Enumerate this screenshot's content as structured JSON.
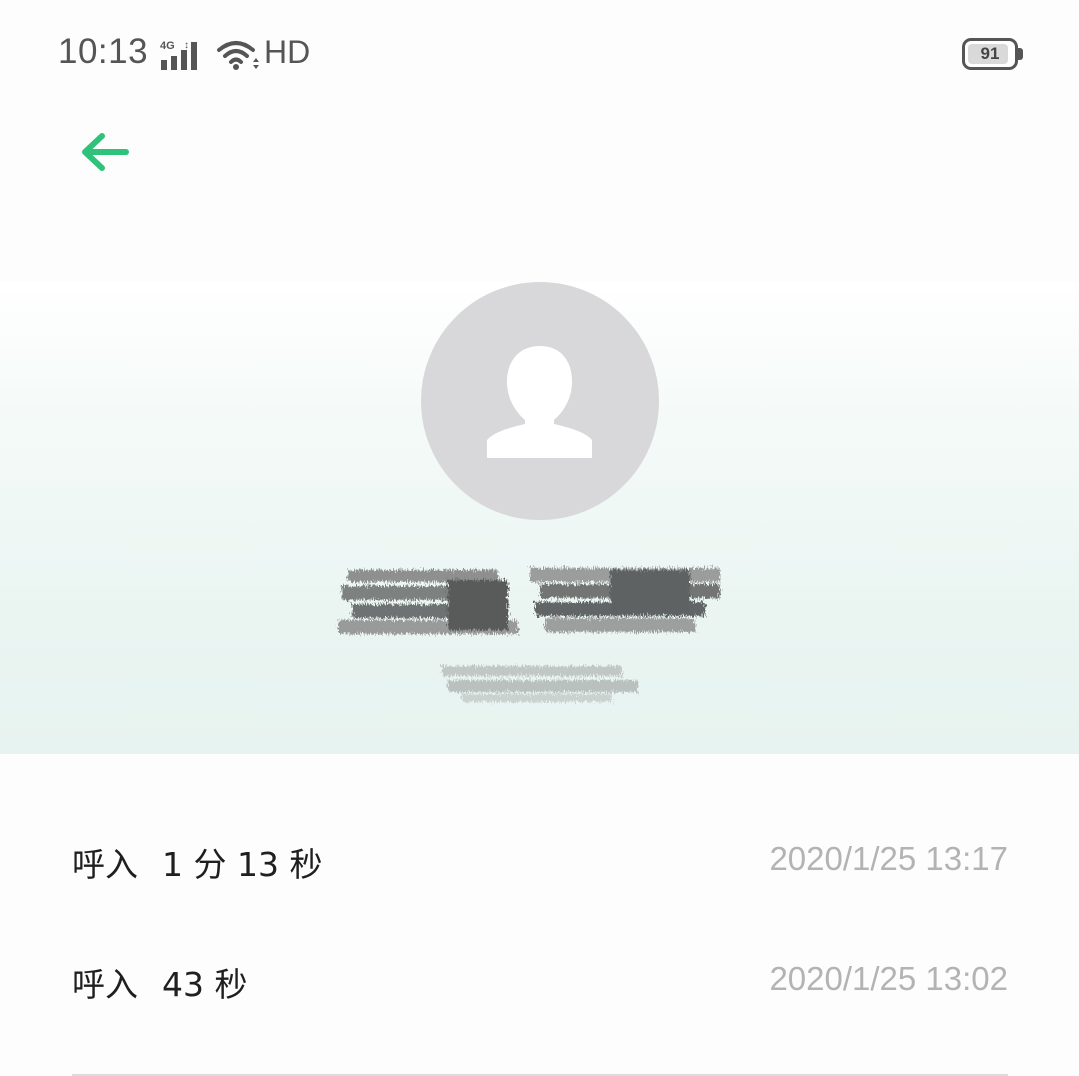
{
  "status_bar": {
    "time": "10:13",
    "network": "4G",
    "hd": "HD",
    "battery": "91",
    "battery_fraction": 0.91
  },
  "toolbar": {
    "back_icon": "back-arrow-icon",
    "accent_color": "#2fc27a"
  },
  "contact": {
    "avatar_icon": "person-silhouette-icon",
    "avatar_bg": "#d8d8da"
  },
  "call_log": [
    {
      "type": "呼入",
      "duration": "1 分 13 秒",
      "time": "2020/1/25 13:17"
    },
    {
      "type": "呼入",
      "duration": "43 秒",
      "time": "2020/1/25 13:02"
    }
  ]
}
